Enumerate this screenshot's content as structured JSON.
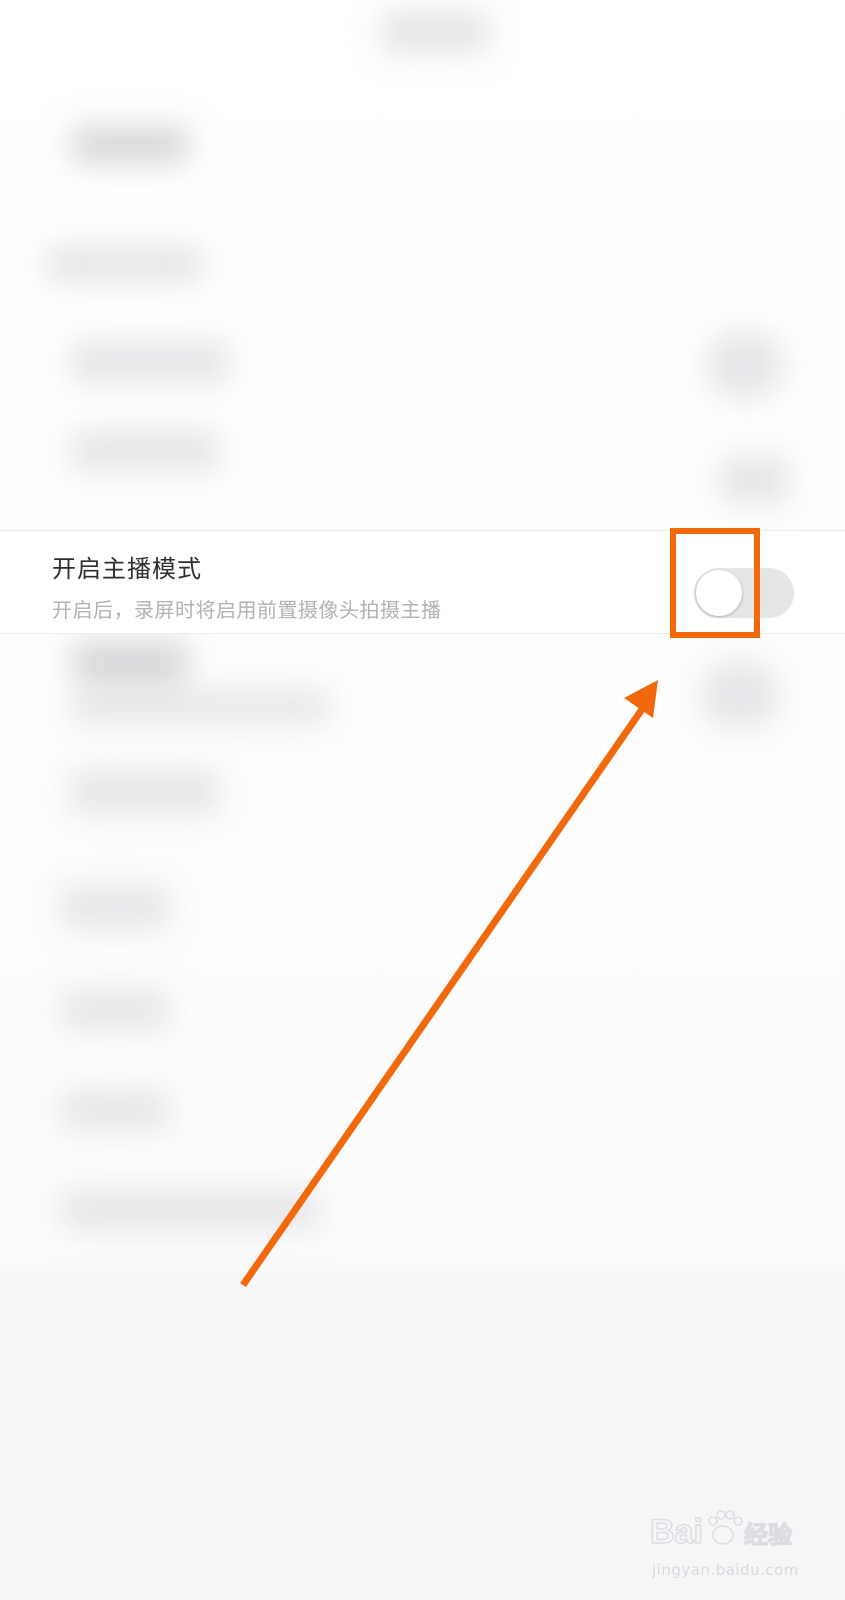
{
  "setting": {
    "title": "开启主播模式",
    "description": "开启后，录屏时将启用前置摄像头拍摄主播",
    "toggle_on": false
  },
  "annotation": {
    "color": "#f2690c"
  },
  "watermark": {
    "brand": "Baidu经验",
    "url": "jingyan.baidu.com"
  },
  "icons": [
    "toggle-switch",
    "arrow-annotation",
    "baidu-paw-logo"
  ]
}
